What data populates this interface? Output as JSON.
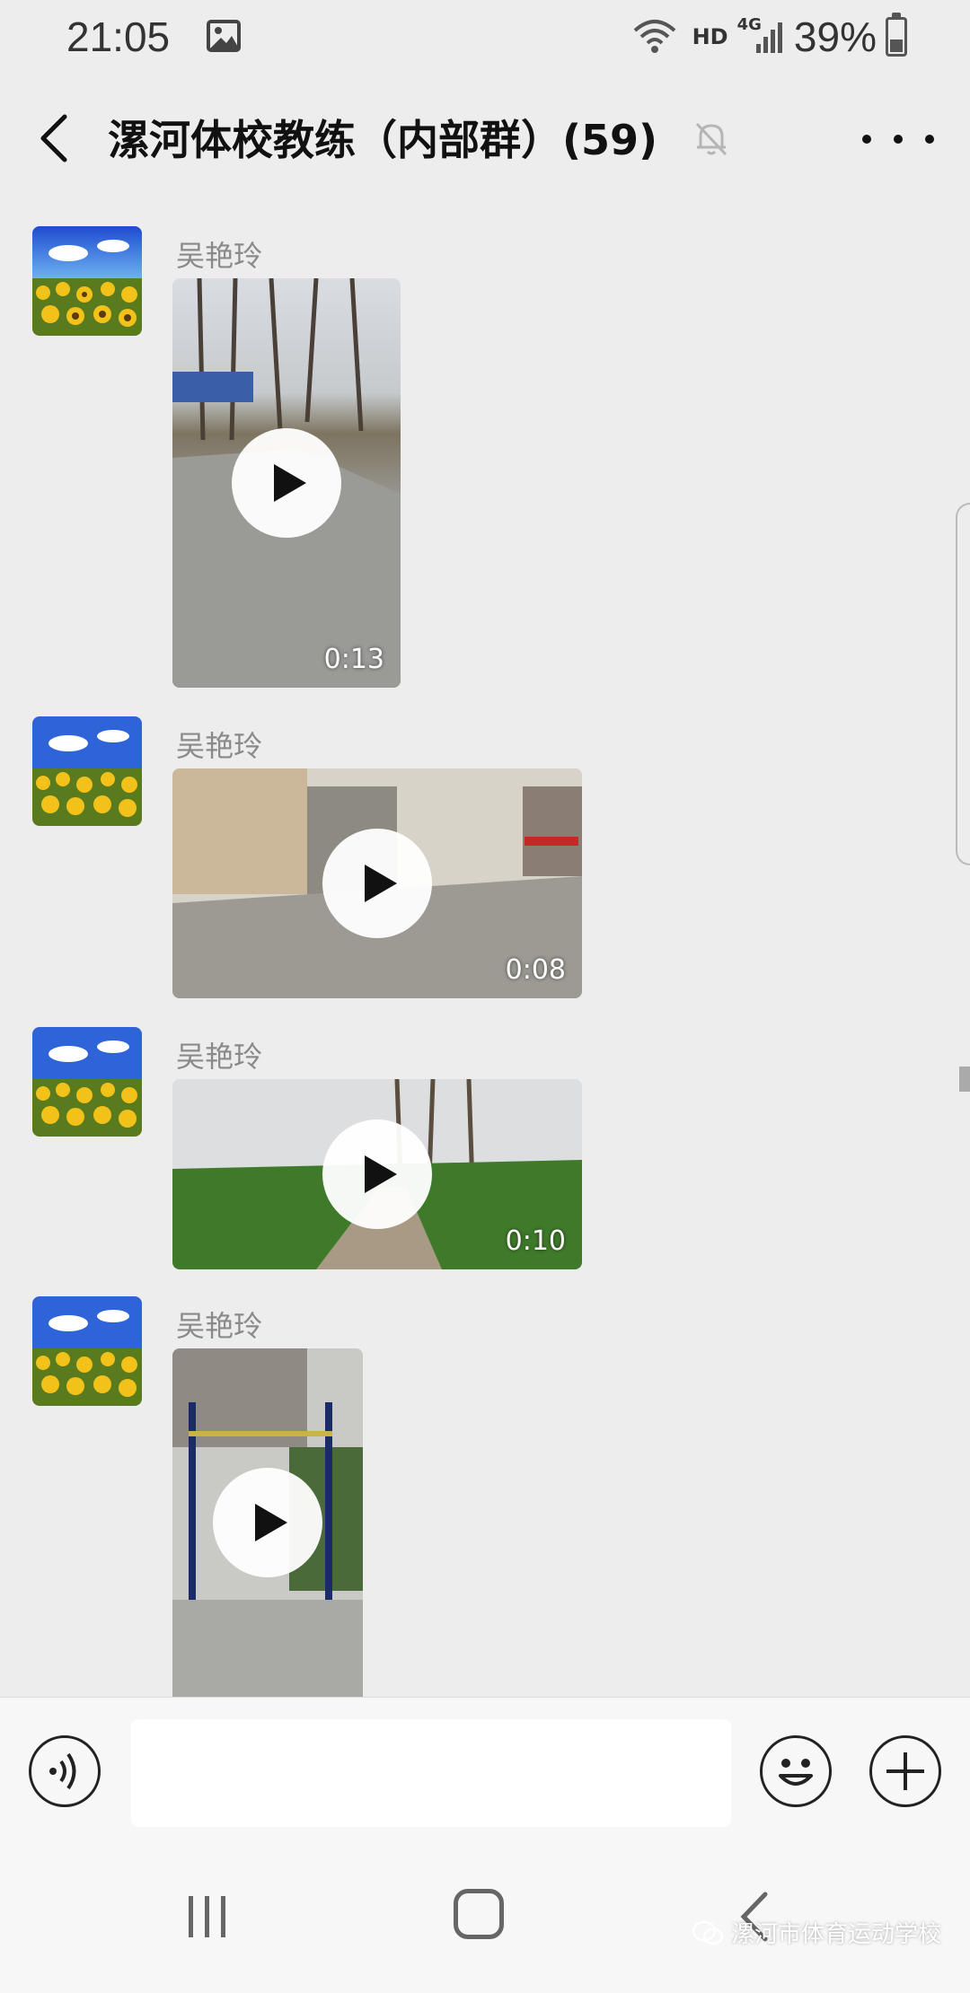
{
  "status_bar": {
    "time": "21:05",
    "network": "HD",
    "network_gen": "4G",
    "battery": "39%",
    "battery_level": 0.39
  },
  "header": {
    "title": "漯河体校教练（内部群）(59)"
  },
  "messages": [
    {
      "sender": "吴艳玲",
      "type": "video",
      "duration": "0:13"
    },
    {
      "sender": "吴艳玲",
      "type": "video",
      "duration": "0:08"
    },
    {
      "sender": "吴艳玲",
      "type": "video",
      "duration": "0:10"
    },
    {
      "sender": "吴艳玲",
      "type": "video",
      "duration": ""
    }
  ],
  "input": {
    "value": "",
    "placeholder": ""
  },
  "watermark": "漯河市体育运动学校",
  "colors": {
    "background": "#ededed",
    "bar": "#f7f7f7",
    "sender_text": "#8a8a8a"
  }
}
